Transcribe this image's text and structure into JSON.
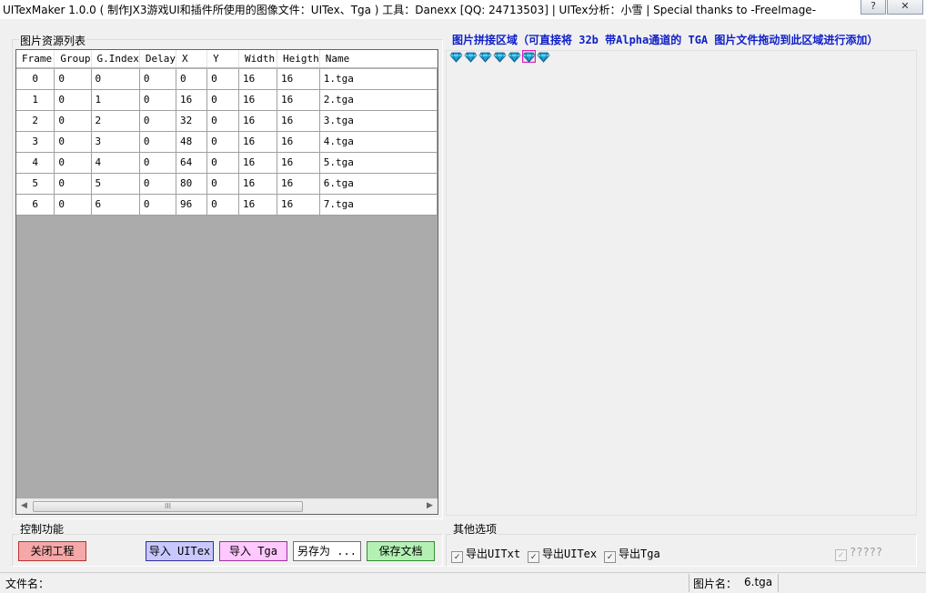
{
  "window": {
    "title": "UITexMaker  1.0.0 ( 制作JX3游戏UI和插件所使用的图像文件：UITex、Tga )   工具：Danexx [QQ: 24713503] | UITex分析：小雪 | Special thanks to -FreeImage-",
    "help_label": "?",
    "close_label": "✕"
  },
  "resource_list": {
    "label": "图片资源列表",
    "columns": [
      "Frame",
      "Group",
      "G.Index",
      "Delay",
      "X",
      "Y",
      "Width",
      "Heigth",
      "Name"
    ],
    "rows": [
      [
        "0",
        "0",
        "0",
        "0",
        "0",
        "0",
        "16",
        "16",
        "1.tga"
      ],
      [
        "1",
        "0",
        "1",
        "0",
        "16",
        "0",
        "16",
        "16",
        "2.tga"
      ],
      [
        "2",
        "0",
        "2",
        "0",
        "32",
        "0",
        "16",
        "16",
        "3.tga"
      ],
      [
        "3",
        "0",
        "3",
        "0",
        "48",
        "0",
        "16",
        "16",
        "4.tga"
      ],
      [
        "4",
        "0",
        "4",
        "0",
        "64",
        "0",
        "16",
        "16",
        "5.tga"
      ],
      [
        "5",
        "0",
        "5",
        "0",
        "80",
        "0",
        "16",
        "16",
        "6.tga"
      ],
      [
        "6",
        "0",
        "6",
        "0",
        "96",
        "0",
        "16",
        "16",
        "7.tga"
      ]
    ],
    "scroll_thumb_label": "III"
  },
  "stitch_area": {
    "label": "图片拼接区域（可直接将 32b 带Alpha通道的 TGA 图片文件拖动到此区域进行添加）",
    "gem_icons": [
      "gem-icon",
      "gem-icon",
      "gem-icon",
      "gem-icon",
      "gem-icon",
      "gem-icon",
      "gem-icon"
    ],
    "selected_index": 5,
    "gem_color": "#1aa8d8",
    "selection_color": "#e020c0"
  },
  "controls": {
    "label": "控制功能",
    "close_project": "关闭工程",
    "import_uitex": "导入 UITex",
    "import_tga": "导入 Tga",
    "save_as": "另存为 ...",
    "save_doc": "保存文档"
  },
  "options": {
    "label": "其他选项",
    "export_uitxt": "导出UITxt",
    "export_uitex": "导出UITex",
    "export_tga": "导出Tga",
    "unknown": "?????",
    "checkmark": "✓"
  },
  "status": {
    "file_label": "文件名：",
    "file_value": "",
    "image_label": "图片名：",
    "image_value": "6.tga"
  },
  "colors": {
    "close_btn_bg": "#f5a8a8",
    "import_uitex_bg": "#c8c8ff",
    "import_tga_bg": "#ffc8ff",
    "save_doc_bg": "#b4f0b4"
  }
}
